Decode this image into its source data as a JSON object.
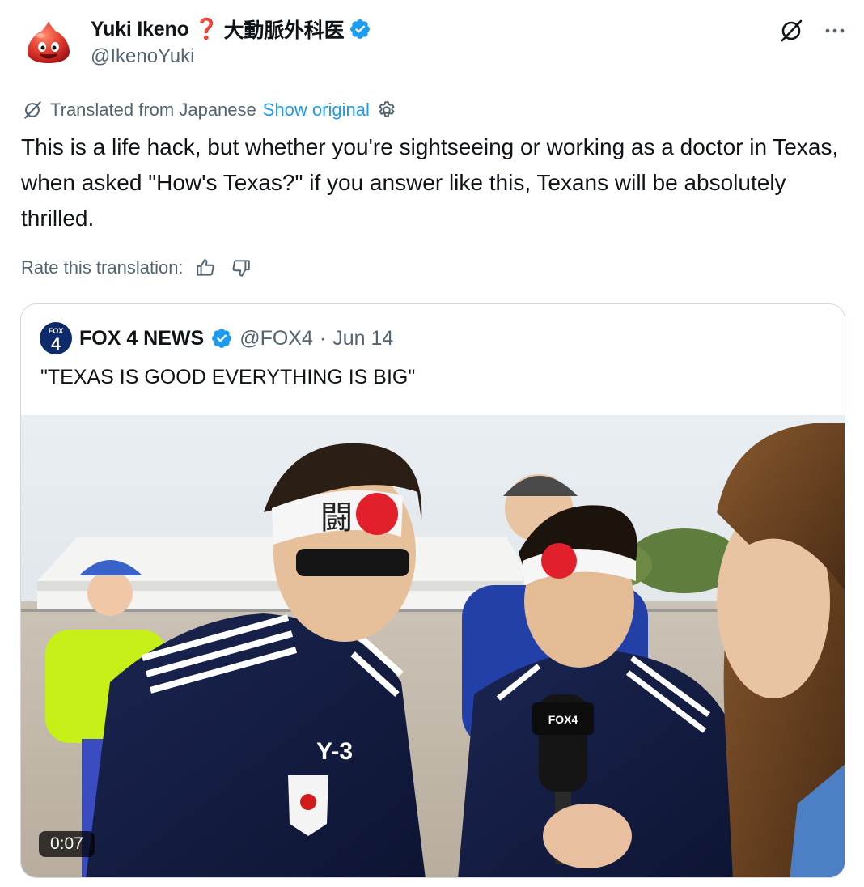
{
  "author": {
    "display_name": "Yuki Ikeno",
    "name_emoji": "❓",
    "name_suffix": "大動脈外科医",
    "handle": "@IkenoYuki",
    "verified": true,
    "avatar_icon": "slime-avatar-icon"
  },
  "actions": {
    "grok_icon": "grok-icon",
    "more_icon": "more-icon"
  },
  "translation": {
    "translated_from": "Translated from Japanese",
    "show_original": "Show original",
    "settings_icon": "gear-icon"
  },
  "tweet": {
    "text": "This is a life hack, but whether you're sightseeing or working as a doctor in Texas, when asked \"How's Texas?\" if you answer like this, Texans will be absolutely thrilled."
  },
  "rate": {
    "label": "Rate this translation:",
    "up_icon": "thumbs-up-icon",
    "down_icon": "thumbs-down-icon"
  },
  "quote": {
    "name": "FOX 4 NEWS",
    "handle": "@FOX4",
    "separator": "·",
    "date": "Jun 14",
    "text": "\"TEXAS IS GOOD EVERYTHING IS BIG\"",
    "logo_text_top": "FOX",
    "logo_text_num": "4",
    "media": {
      "duration": "0:07",
      "headband_text": "闘",
      "shirt_brand": "Y-3",
      "mic_label": "FOX4"
    }
  },
  "colors": {
    "accent": "#1d9bf0",
    "secondary_text": "#536471",
    "border": "#cfd9de"
  }
}
